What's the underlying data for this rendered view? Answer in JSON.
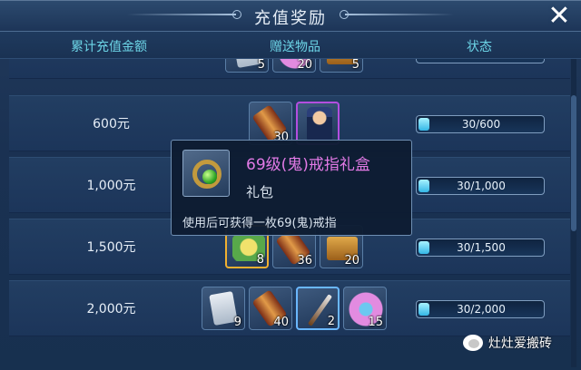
{
  "window": {
    "title": "充值奖励",
    "close_label": "✕"
  },
  "columns": {
    "amount": "累计充值金额",
    "items": "赠送物品",
    "status": "状态"
  },
  "partial_row": {
    "counts": [
      "5",
      "20",
      "5"
    ]
  },
  "rows": [
    {
      "amount": "600元",
      "items": [
        {
          "icon": "scroll-icon",
          "count": "30"
        },
        {
          "icon": "character-portrait-icon",
          "count": ""
        }
      ],
      "status": "30/600",
      "progress": 0.05
    },
    {
      "amount": "1,000元",
      "items": [],
      "status": "30/1,000",
      "progress": 0.03
    },
    {
      "amount": "1,500元",
      "items": [
        {
          "icon": "leaf-orb-icon",
          "count": "8"
        },
        {
          "icon": "scroll-icon",
          "count": "36"
        },
        {
          "icon": "treasure-chest-icon",
          "count": "20"
        }
      ],
      "status": "30/1,500",
      "progress": 0.02
    },
    {
      "amount": "2,000元",
      "items": [
        {
          "icon": "paper-scroll-icon",
          "count": "9"
        },
        {
          "icon": "scroll-icon",
          "count": "40"
        },
        {
          "icon": "brush-icon",
          "count": "2"
        },
        {
          "icon": "flower-icon",
          "count": "15"
        }
      ],
      "status": "30/2,000",
      "progress": 0.015
    }
  ],
  "tooltip": {
    "name": "69级(鬼)戒指礼盒",
    "type": "礼包",
    "description": "使用后可获得一枚69(鬼)戒指",
    "icon": "ring-icon"
  },
  "watermark": {
    "text": "灶灶爱搬砖",
    "icon": "wechat-icon"
  },
  "colors": {
    "header_text": "#6cd4e6",
    "tooltip_name": "#e27ae6",
    "progress": "#34b7e6"
  }
}
